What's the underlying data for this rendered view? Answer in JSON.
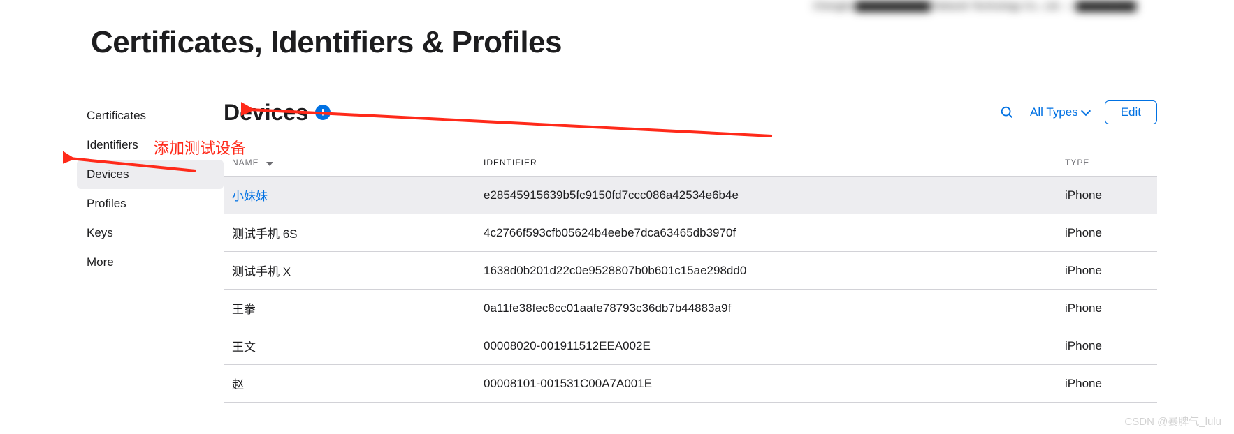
{
  "top_header_blur": "Chengdu ▇▇▇▇▇▇▇▇▇▇ Network Technology Co., Ltd. — ▇▇▇▇▇▇▇▇",
  "page_title": "Certificates, Identifiers & Profiles",
  "sidebar": {
    "items": [
      {
        "label": "Certificates",
        "active": false
      },
      {
        "label": "Identifiers",
        "active": false
      },
      {
        "label": "Devices",
        "active": true
      },
      {
        "label": "Profiles",
        "active": false
      },
      {
        "label": "Keys",
        "active": false
      },
      {
        "label": "More",
        "active": false
      }
    ]
  },
  "section": {
    "title": "Devices",
    "add_glyph": "+",
    "filter_label": "All Types",
    "edit_label": "Edit"
  },
  "table": {
    "headers": {
      "name": "NAME",
      "identifier": "IDENTIFIER",
      "type": "TYPE"
    },
    "rows": [
      {
        "name": "小妹妹",
        "identifier": "e28545915639b5fc9150fd7ccc086a42534e6b4e",
        "type": "iPhone",
        "selected": true
      },
      {
        "name": "测试手机 6S",
        "identifier": "4c2766f593cfb05624b4eebe7dca63465db3970f",
        "type": "iPhone",
        "selected": false
      },
      {
        "name": "测试手机 X",
        "identifier": "1638d0b201d22c0e9528807b0b601c15ae298dd0",
        "type": "iPhone",
        "selected": false
      },
      {
        "name": "王拳",
        "identifier": "0a11fe38fec8cc01aafe78793c36db7b44883a9f",
        "type": "iPhone",
        "selected": false
      },
      {
        "name": "王文",
        "identifier": "00008020-001911512EEA002E",
        "type": "iPhone",
        "selected": false
      },
      {
        "name": "赵",
        "identifier": "00008101-001531C00A7A001E",
        "type": "iPhone",
        "selected": false
      }
    ]
  },
  "annotations": {
    "add_device_text": "添加测试设备"
  },
  "watermark": "CSDN @暴脾气_lulu"
}
